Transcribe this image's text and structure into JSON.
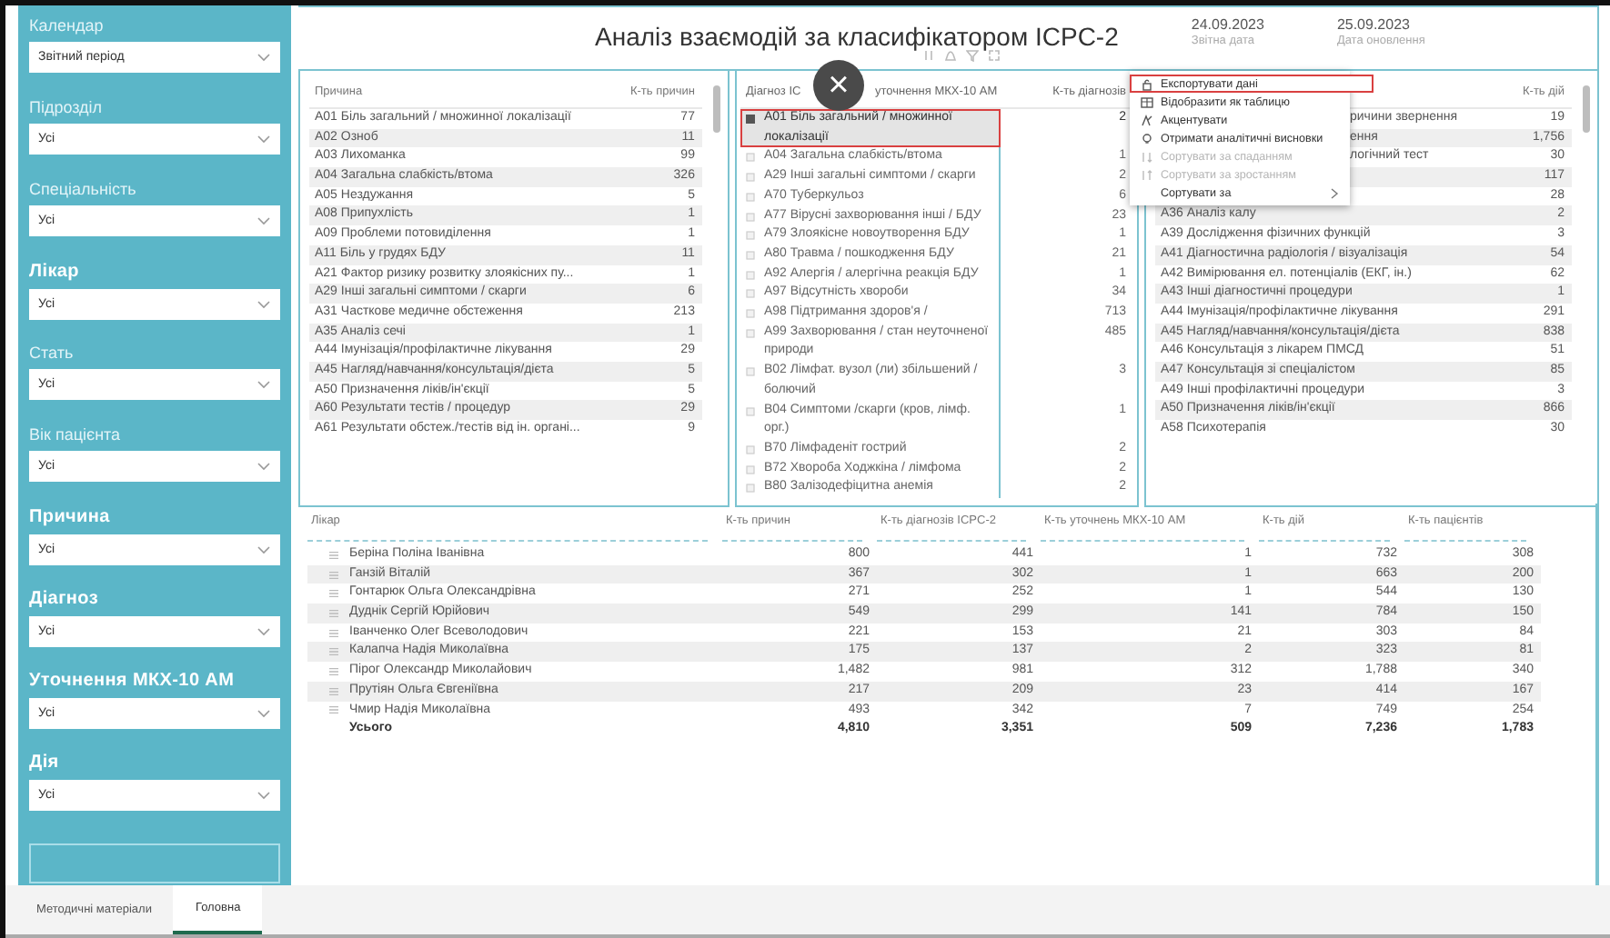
{
  "sidebar": {
    "filters": [
      {
        "label": "Календар",
        "value": "Звітний період",
        "emphasis": false
      },
      {
        "label": "Підрозділ",
        "value": "Усі",
        "emphasis": false
      },
      {
        "label": "Спеціальність",
        "value": "Усі",
        "emphasis": false
      },
      {
        "label": "Лікар",
        "value": "Усі",
        "emphasis": true
      },
      {
        "label": "Стать",
        "value": "Усі",
        "emphasis": false
      },
      {
        "label": "Вік пацієнта",
        "value": "Усі",
        "emphasis": false
      },
      {
        "label": "Причина",
        "value": "Усі",
        "emphasis": true
      },
      {
        "label": "Діагноз",
        "value": "Усі",
        "emphasis": true
      },
      {
        "label": "Уточнення МКХ-10 АМ",
        "value": "Усі",
        "emphasis": true
      },
      {
        "label": "Дія",
        "value": "Усі",
        "emphasis": true
      }
    ]
  },
  "header": {
    "title": "Аналіз взаємодій за класифікатором ICPC-2",
    "dates": [
      {
        "date": "24.09.2023",
        "caption": "Звітна дата"
      },
      {
        "date": "25.09.2023",
        "caption": "Дата оновлення"
      }
    ]
  },
  "reasons_table": {
    "columns": [
      "Причина",
      "К-ть причин"
    ],
    "rows": [
      {
        "name": "A01 Біль загальний / множинної локалізації",
        "count": "77"
      },
      {
        "name": "A02 Озноб",
        "count": "11"
      },
      {
        "name": "A03 Лихоманка",
        "count": "99"
      },
      {
        "name": "A04 Загальна слабкість/втома",
        "count": "326"
      },
      {
        "name": "A05 Нездужання",
        "count": "5"
      },
      {
        "name": "A08 Припухлість",
        "count": "1"
      },
      {
        "name": "A09 Проблеми потовиділення",
        "count": "1"
      },
      {
        "name": "A11 Біль у грудях БДУ",
        "count": "11"
      },
      {
        "name": "A21 Фактор ризику розвитку злоякісних пу...",
        "count": "1"
      },
      {
        "name": "A29 Інші загальні симптоми / скарги",
        "count": "6"
      },
      {
        "name": "A31 Часткове медичне обстеження",
        "count": "213"
      },
      {
        "name": "A35 Аналіз сечі",
        "count": "1"
      },
      {
        "name": "A44 Імунізація/профілактичне лікування",
        "count": "29"
      },
      {
        "name": "A45 Нагляд/навчання/консультація/дієта",
        "count": "5"
      },
      {
        "name": "A50 Призначення ліків/ін'єкції",
        "count": "5"
      },
      {
        "name": "A60 Результати тестів / процедур",
        "count": "29"
      },
      {
        "name": "A61 Результати обстеж./тестів від ін. органі...",
        "count": "9"
      }
    ]
  },
  "diagnosis_table": {
    "columns": [
      "Діагноз IC",
      "уточнення МКХ-10 АМ",
      "К-ть діагнозів"
    ],
    "close_button": "×",
    "rows": [
      {
        "name": "A01 Біль загальний / множинної локалізації",
        "count": "2",
        "selected": true
      },
      {
        "name": "A04 Загальна слабкість/втома",
        "count": "1",
        "selected": false
      },
      {
        "name": "A29 Інші загальні симптоми / скарги",
        "count": "2",
        "selected": false
      },
      {
        "name": "A70 Туберкульоз",
        "count": "6",
        "selected": false
      },
      {
        "name": "A77 Вірусні захворювання інші / БДУ",
        "count": "23",
        "selected": false
      },
      {
        "name": "A79 Злоякісне новоутворення БДУ",
        "count": "1",
        "selected": false
      },
      {
        "name": "A80 Травма / пошкодження БДУ",
        "count": "21",
        "selected": false
      },
      {
        "name": "A92 Алергія / алергічна реакція БДУ",
        "count": "1",
        "selected": false
      },
      {
        "name": "A97 Відсутність хвороби",
        "count": "34",
        "selected": false
      },
      {
        "name": "A98 Підтримання здоров'я /",
        "count": "713",
        "selected": false
      },
      {
        "name": "A99 Захворювання / стан неуточненої природи",
        "count": "485",
        "selected": false
      },
      {
        "name": "B02 Лімфат. вузол (ли) збільшений / болючий",
        "count": "3",
        "selected": false
      },
      {
        "name": "B04 Симптоми /скарги (кров, лімф. орг.)",
        "count": "1",
        "selected": false
      },
      {
        "name": "B70 Лімфаденіт гострий",
        "count": "2",
        "selected": false
      },
      {
        "name": "B72 Хвороба Ходжкіна / лімфома",
        "count": "2",
        "selected": false
      },
      {
        "name": "B80 Залізодефіцитна анемія",
        "count": "2",
        "selected": false
      }
    ]
  },
  "actions_table": {
    "columns": [
      "К-ть дій"
    ],
    "rows_under_menu": [
      {
        "name": "ричини звернення",
        "count": "19"
      },
      {
        "name": "ення",
        "count": "1,756"
      },
      {
        "name": "логічний тест",
        "count": "30"
      },
      {
        "count": "117"
      },
      {
        "count": "28"
      }
    ],
    "rows": [
      {
        "name": "A36 Аналіз калу",
        "count": "2"
      },
      {
        "name": "A39 Дослідження фізичних функцій",
        "count": "3"
      },
      {
        "name": "A41 Діагностична радіологія / візуалізація",
        "count": "54"
      },
      {
        "name": "A42 Вимірювання ел. потенціалів (ЕКГ, ін.)",
        "count": "62"
      },
      {
        "name": "A43 Інші діагностичні процедури",
        "count": "1"
      },
      {
        "name": "A44 Імунізація/профілактичне лікування",
        "count": "291"
      },
      {
        "name": "A45 Нагляд/навчання/консультація/дієта",
        "count": "838"
      },
      {
        "name": "A46 Консультація з лікарем ПМСД",
        "count": "51"
      },
      {
        "name": "A47 Консультація зі спеціалістом",
        "count": "85"
      },
      {
        "name": "A49 Інші профілактичні процедури",
        "count": "3"
      },
      {
        "name": "A50 Призначення ліків/ін'єкції",
        "count": "866"
      },
      {
        "name": "A58 Психотерапія",
        "count": "30"
      }
    ]
  },
  "context_menu": {
    "items": [
      {
        "label": "Експортувати дані",
        "kind": "export",
        "highlighted": true,
        "disabled": false
      },
      {
        "label": "Відобразити як таблицю",
        "kind": "table",
        "highlighted": false,
        "disabled": false
      },
      {
        "label": "Акцентувати",
        "kind": "spotlight",
        "highlighted": false,
        "disabled": false
      },
      {
        "label": "Отримати аналітичні висновки",
        "kind": "insights",
        "highlighted": false,
        "disabled": false
      },
      {
        "label": "Сортувати за спаданням",
        "kind": "sort-desc",
        "highlighted": false,
        "disabled": true
      },
      {
        "label": "Сортувати за зростанням",
        "kind": "sort-asc",
        "highlighted": false,
        "disabled": true
      },
      {
        "label": "Сортувати за",
        "kind": "submenu",
        "highlighted": false,
        "disabled": false
      }
    ]
  },
  "doctors_table": {
    "columns": [
      "Лікар",
      "К-ть причин",
      "К-ть діагнозів ICPC-2",
      "К-ть уточнень МКХ-10 АМ",
      "К-ть дій",
      "К-ть пацієнтів"
    ],
    "rows": [
      {
        "cells": [
          "Беріна Поліна Іванівна",
          "800",
          "441",
          "1",
          "732",
          "308"
        ]
      },
      {
        "cells": [
          "Ганзій Віталій",
          "367",
          "302",
          "1",
          "663",
          "200"
        ]
      },
      {
        "cells": [
          "Гонтарюк Ольга Олександрівна",
          "271",
          "252",
          "1",
          "544",
          "130"
        ]
      },
      {
        "cells": [
          "Дуднік Сергій Юрійович",
          "549",
          "299",
          "141",
          "784",
          "150"
        ]
      },
      {
        "cells": [
          "Іванченко Олег Всеволодович",
          "221",
          "153",
          "21",
          "303",
          "84"
        ]
      },
      {
        "cells": [
          "Калапча Надія Миколаївна",
          "175",
          "137",
          "2",
          "323",
          "81"
        ]
      },
      {
        "cells": [
          "Пірог Олександр Миколайович",
          "1,482",
          "981",
          "312",
          "1,788",
          "340"
        ]
      },
      {
        "cells": [
          "Прутіян Ольга Євгеніївна",
          "217",
          "209",
          "23",
          "414",
          "167"
        ]
      },
      {
        "cells": [
          "Чмир Надія Миколаївна",
          "493",
          "342",
          "7",
          "749",
          "254"
        ]
      }
    ],
    "total": [
      "Усього",
      "4,810",
      "3,351",
      "509",
      "7,236",
      "1,783"
    ]
  },
  "tabs": [
    {
      "label": "Методичні матеріали",
      "selected": false
    },
    {
      "label": "Головна",
      "selected": true
    }
  ]
}
